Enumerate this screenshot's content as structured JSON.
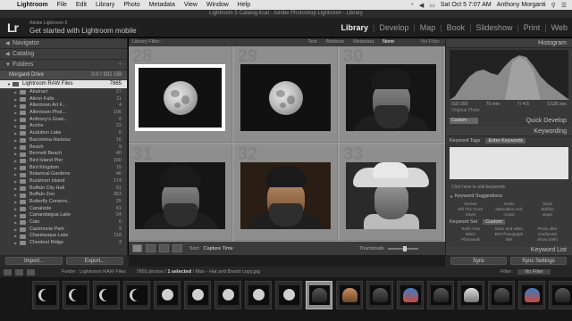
{
  "menubar": {
    "items": [
      "Lightroom",
      "File",
      "Edit",
      "Library",
      "Photo",
      "Metadata",
      "View",
      "Window",
      "Help"
    ],
    "time": "Sat Oct 5  7:07 AM",
    "user": "Anthony Morganti"
  },
  "window_title": "Lightroom 5 Catalog.lrcat - Adobe Photoshop Lightroom - Library",
  "identity": {
    "logo": "Lr",
    "subtitle": "Adobe Lightroom 5",
    "title": "Get started with Lightroom mobile"
  },
  "modules": [
    "Library",
    "Develop",
    "Map",
    "Book",
    "Slideshow",
    "Print",
    "Web"
  ],
  "active_module": "Library",
  "left_panel": {
    "navigator": "Navigator",
    "catalog": "Catalog",
    "folders": "Folders",
    "volume": {
      "name": "Morganti Drive",
      "info": "0.0 / 931 GB"
    },
    "root_folder": {
      "name": "Lightroom RAW Files",
      "count": "7865"
    },
    "subfolders": [
      {
        "name": "Abstract",
        "count": "27"
      },
      {
        "name": "Akron Falls",
        "count": "11"
      },
      {
        "name": "Allentown Art F...",
        "count": "4"
      },
      {
        "name": "Allentown Phot...",
        "count": "106"
      },
      {
        "name": "Anthony's Grad...",
        "count": "6"
      },
      {
        "name": "Archie",
        "count": "23"
      },
      {
        "name": "Audubon Lake",
        "count": "6"
      },
      {
        "name": "Barcelona Harbour",
        "count": "16"
      },
      {
        "name": "Beach",
        "count": "9"
      },
      {
        "name": "Bennett Beach",
        "count": "40"
      },
      {
        "name": "Bird Island Pier",
        "count": "160"
      },
      {
        "name": "Bird Kingdom",
        "count": "15"
      },
      {
        "name": "Botanical Gardens",
        "count": "46"
      },
      {
        "name": "Buckhorn Island",
        "count": "174"
      },
      {
        "name": "Buffalo City Hall",
        "count": "61"
      },
      {
        "name": "Buffalo Zoo",
        "count": "353"
      },
      {
        "name": "Butterfly Conserv...",
        "count": "25"
      },
      {
        "name": "Canalside",
        "count": "61"
      },
      {
        "name": "Canandaigua Lake",
        "count": "24"
      },
      {
        "name": "Cats",
        "count": "6"
      },
      {
        "name": "Cazenovia Park",
        "count": "9"
      },
      {
        "name": "Chautauqua Lake",
        "count": "118"
      },
      {
        "name": "Chestnut Ridge",
        "count": "3"
      }
    ],
    "import_button": "Import...",
    "export_button": "Export..."
  },
  "filter_bar": {
    "label": "Library Filter :",
    "options": [
      "Text",
      "Attribute",
      "Metadata",
      "None"
    ],
    "active": "None",
    "right": "No Filter"
  },
  "grid": {
    "cells": [
      {
        "index": "28",
        "kind": "moon-white"
      },
      {
        "index": "29",
        "kind": "moon"
      },
      {
        "index": "30",
        "kind": "man-hat"
      },
      {
        "index": "31",
        "kind": "man-hat"
      },
      {
        "index": "32",
        "kind": "man-hat-warm"
      },
      {
        "index": "33",
        "kind": "cowboy"
      }
    ]
  },
  "toolbar": {
    "sort_label": "Sort:",
    "sort_value": "Capture Time",
    "thumbnails_label": "Thumbnails",
    "thumbnail_size": 0.55
  },
  "right_panel": {
    "histogram": "Histogram",
    "histo_info": [
      "ISO 200",
      "70 mm",
      "f / 4.5",
      "1/125 sec"
    ],
    "original_photo": "Original Photo",
    "preset": "Custom",
    "quick_develop": "Quick Develop",
    "keywording": "Keywording",
    "keyword_tags_label": "Keyword Tags",
    "keyword_tags_value": "Enter Keywords",
    "click_hint": "Click here to add keywords",
    "keyword_suggestions": "Keyword Suggestions",
    "suggestions": [
      "festival",
      "music",
      "band",
      "Bill The Clock",
      "alternative rock",
      "Buffalo",
      "travel",
      "crowd",
      "stage"
    ],
    "keyword_set_label": "Keyword Set",
    "keyword_set_value": "Custom",
    "set_keywords": [
      "Tenth Year",
      "black and white",
      "Photo after",
      "BWH",
      "BW Photograph",
      "medium55",
      "Photowalk",
      "BW",
      "Show Delhi"
    ],
    "keyword_list": "Keyword List",
    "sync_button": "Sync",
    "sync_settings_button": "Sync Settings"
  },
  "filmstrip_bar": {
    "breadcrumb": "Folder : Lightroom RAW Files",
    "count": "7865 photos /",
    "selected": "1 selected",
    "file": "/ Man - Hat and Beard copy.jpg",
    "filter_label": "Filter :",
    "filter_value": "No Filter"
  },
  "filmstrip": [
    "crescent",
    "crescent",
    "crescent",
    "crescent",
    "fullmoon",
    "fullmoon",
    "fullmoon",
    "fullmoon",
    "fullmoon",
    "portrait",
    "portrait-warm",
    "portrait",
    "portrait-colour",
    "portrait",
    "portrait-light",
    "portrait",
    "portrait-colour",
    "portrait",
    "portrait-green",
    "portrait"
  ],
  "filmstrip_selected_index": 9
}
